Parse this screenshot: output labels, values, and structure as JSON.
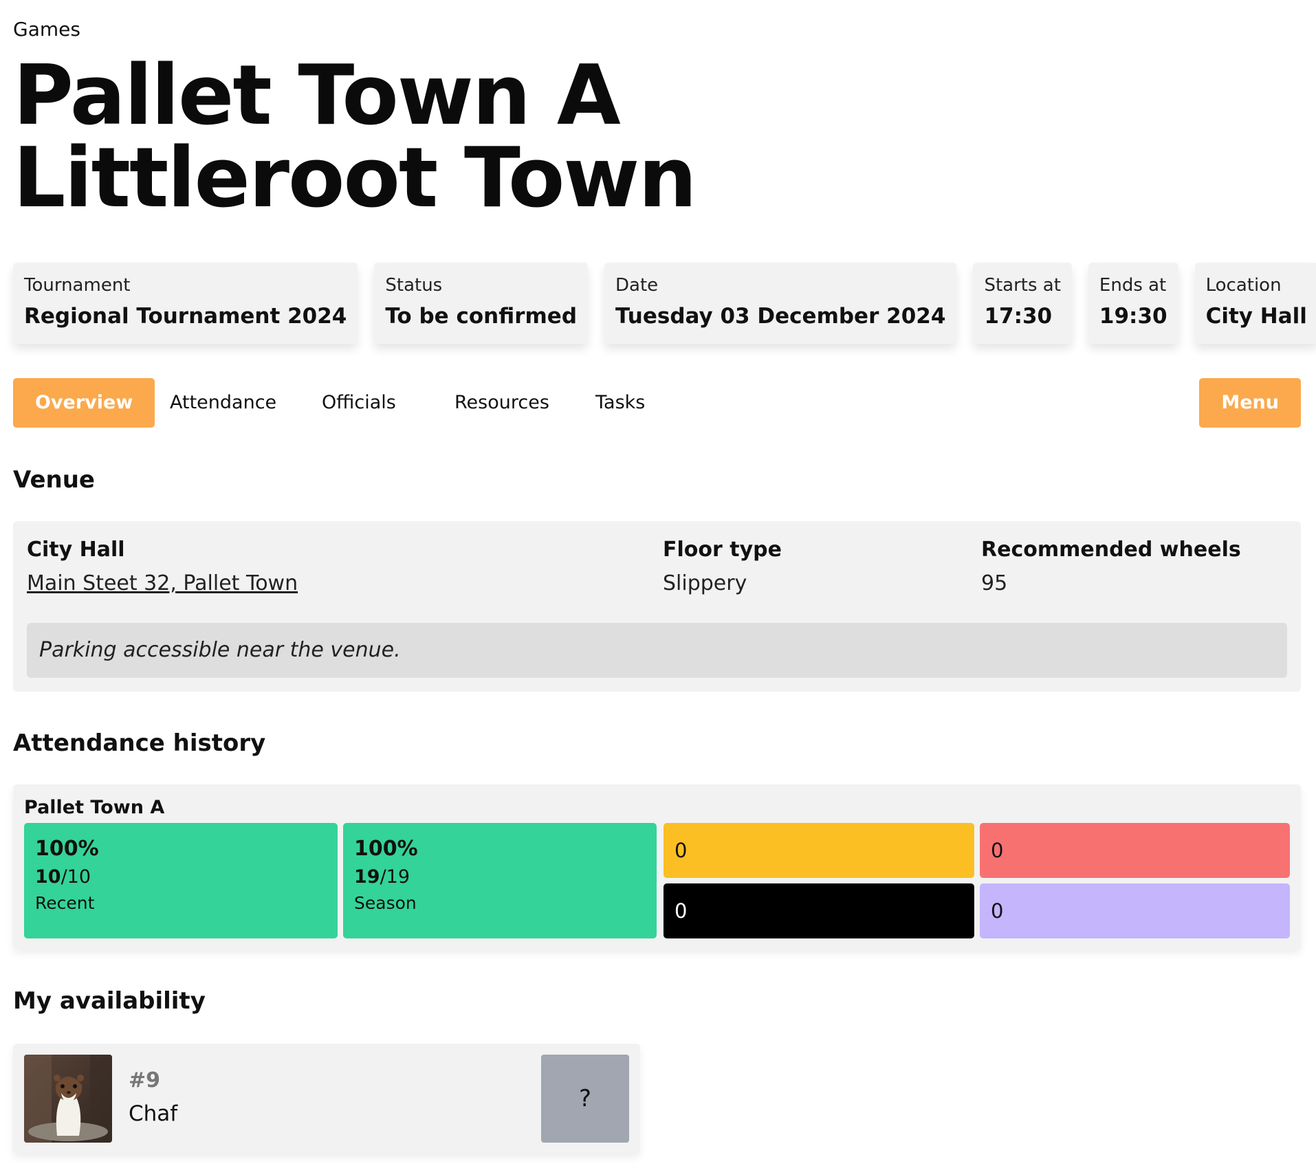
{
  "breadcrumb": "Games",
  "title": {
    "line1": "Pallet Town A",
    "line2": "Littleroot Town"
  },
  "info": {
    "tournament": {
      "label": "Tournament",
      "value": "Regional Tournament 2024"
    },
    "status": {
      "label": "Status",
      "value": "To be confirmed"
    },
    "date": {
      "label": "Date",
      "value": "Tuesday 03 December 2024"
    },
    "starts": {
      "label": "Starts at",
      "value": "17:30"
    },
    "ends": {
      "label": "Ends at",
      "value": "19:30"
    },
    "location": {
      "label": "Location",
      "value": "City Hall"
    }
  },
  "tabs": {
    "overview": "Overview",
    "attendance": "Attendance",
    "officials": "Officials",
    "resources": "Resources",
    "tasks": "Tasks",
    "menu": "Menu"
  },
  "venue": {
    "heading": "Venue",
    "name": "City Hall",
    "address": "Main Steet 32, Pallet Town",
    "floor_label": "Floor type",
    "floor_value": "Slippery",
    "wheels_label": "Recommended wheels",
    "wheels_value": "95",
    "note": "Parking accessible near the venue."
  },
  "attendance": {
    "heading": "Attendance history",
    "team": "Pallet Town A",
    "recent": {
      "pct": "100%",
      "attended": "10",
      "total": "/10",
      "label": "Recent"
    },
    "season": {
      "pct": "100%",
      "attended": "19",
      "total": "/19",
      "label": "Season"
    },
    "counts": {
      "yellow": "0",
      "red": "0",
      "black": "0",
      "purple": "0"
    },
    "colors": {
      "green": "#34d399",
      "yellow": "#fbbf24",
      "red": "#f87171",
      "black": "#000000",
      "purple": "#c4b5fd"
    }
  },
  "availability": {
    "heading": "My availability",
    "number": "#9",
    "name": "Chaf",
    "button": "?"
  },
  "colors": {
    "accent": "#fba94c",
    "card_bg": "#f2f2f2"
  }
}
